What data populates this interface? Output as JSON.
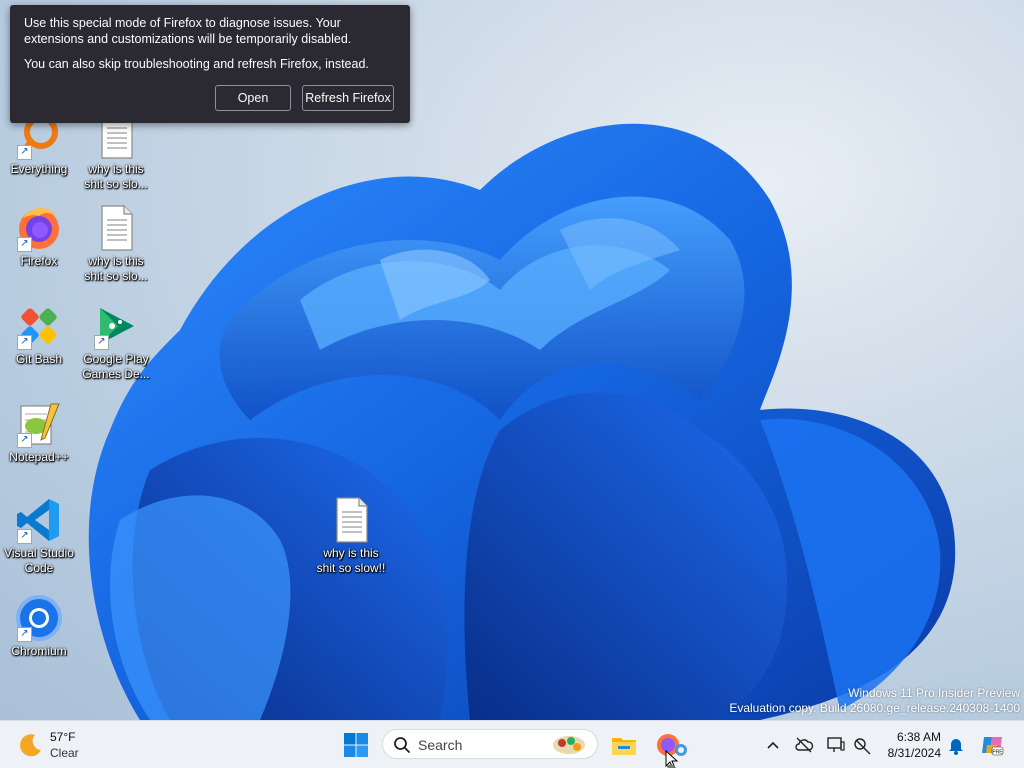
{
  "desktop": {
    "icons": [
      {
        "label": "Everything",
        "icon": "everything-icon"
      },
      {
        "label": "why is this shit so slo...",
        "icon": "text-file-icon"
      },
      {
        "label": "Firefox",
        "icon": "firefox-icon"
      },
      {
        "label": "why is this shit so slo...",
        "icon": "text-file-icon"
      },
      {
        "label": "Git Bash",
        "icon": "git-bash-icon"
      },
      {
        "label": "Google Play Games De...",
        "icon": "google-play-games-icon"
      },
      {
        "label": "Notepad++",
        "icon": "notepadpp-icon"
      },
      {
        "label": "Visual Studio Code",
        "icon": "vscode-icon"
      },
      {
        "label": "Chromium",
        "icon": "chromium-icon"
      },
      {
        "label": "why is this shit so slow!!",
        "icon": "text-file-icon"
      }
    ],
    "watermark": {
      "line1": "Windows 11 Pro Insider Preview",
      "line2": "Evaluation copy. Build 26080.ge_release.240308-1400"
    }
  },
  "popup": {
    "message1": "Use this special mode of Firefox to diagnose issues. Your extensions and customizations will be temporarily disabled.",
    "message2": "You can also skip troubleshooting and refresh Firefox, instead.",
    "open_label": "Open",
    "refresh_label": "Refresh Firefox"
  },
  "taskbar": {
    "weather": {
      "temp": "57°F",
      "condition": "Clear"
    },
    "search_placeholder": "Search",
    "time": "6:38 AM",
    "date": "8/31/2024"
  },
  "colors": {
    "popup_bg": "#2b2a33",
    "taskbar_bg": "#eef2f7",
    "bloom_blue": "#1565e0"
  }
}
